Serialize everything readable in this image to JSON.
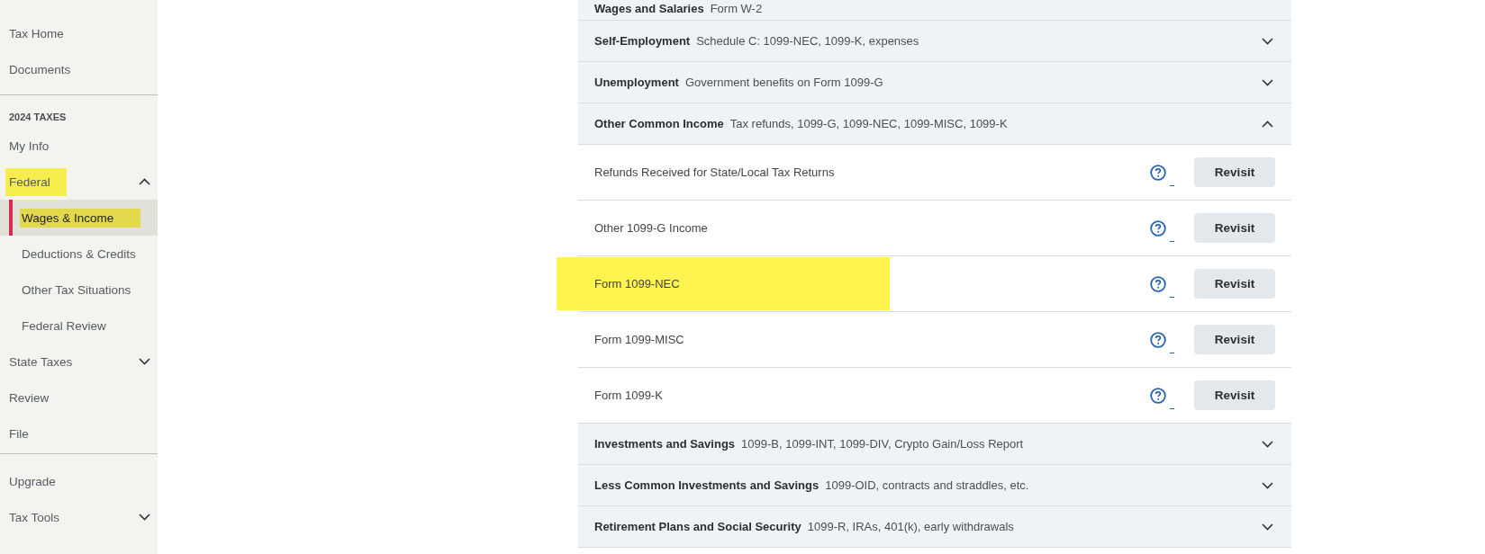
{
  "sidebar": {
    "sections": [
      {
        "items": [
          {
            "label": "Tax Home",
            "selected": false,
            "highlighted": false
          },
          {
            "label": "Documents",
            "selected": false,
            "highlighted": false
          }
        ]
      },
      {
        "heading": "2024 TAXES",
        "items": [
          {
            "label": "My Info",
            "selected": false,
            "highlighted": false
          },
          {
            "label": "Federal",
            "selected": false,
            "highlighted": true,
            "expanded": true,
            "children": [
              {
                "label": "Wages & Income",
                "selected": true,
                "highlighted": true
              },
              {
                "label": "Deductions & Credits",
                "selected": false,
                "highlighted": false
              },
              {
                "label": "Other Tax Situations",
                "selected": false,
                "highlighted": false
              },
              {
                "label": "Federal Review",
                "selected": false,
                "highlighted": false
              }
            ]
          },
          {
            "label": "State Taxes",
            "selected": false,
            "highlighted": false,
            "expanded": false
          },
          {
            "label": "Review",
            "selected": false,
            "highlighted": false
          },
          {
            "label": "File",
            "selected": false,
            "highlighted": false
          }
        ]
      },
      {
        "items": [
          {
            "label": "Upgrade",
            "selected": false,
            "highlighted": false
          },
          {
            "label": "Tax Tools",
            "selected": false,
            "highlighted": false,
            "expanded": false
          }
        ]
      }
    ]
  },
  "income_sections": [
    {
      "title": "Wages and Salaries",
      "description": "Form W-2"
    },
    {
      "title": "Self-Employment",
      "description": "Schedule C: 1099-NEC, 1099-K, expenses",
      "expanded": false
    },
    {
      "title": "Unemployment",
      "description": "Government benefits on Form 1099-G",
      "expanded": false
    },
    {
      "title": "Other Common Income",
      "description": "Tax refunds, 1099-G, 1099-NEC, 1099-MISC, 1099-K",
      "expanded": true,
      "topics": [
        {
          "label": "Refunds Received for State/Local Tax Returns",
          "highlighted": false,
          "button": "Revisit"
        },
        {
          "label": "Other 1099-G Income",
          "highlighted": false,
          "button": "Revisit"
        },
        {
          "label": "Form 1099-NEC",
          "highlighted": true,
          "button": "Revisit"
        },
        {
          "label": "Form 1099-MISC",
          "highlighted": false,
          "button": "Revisit"
        },
        {
          "label": "Form 1099-K",
          "highlighted": false,
          "button": "Revisit"
        }
      ]
    },
    {
      "title": "Investments and Savings",
      "description": "1099-B, 1099-INT, 1099-DIV, Crypto Gain/Loss Report",
      "expanded": false
    },
    {
      "title": "Less Common Investments and Savings",
      "description": "1099-OID, contracts and straddles, etc.",
      "expanded": false
    },
    {
      "title": "Retirement Plans and Social Security",
      "description": "1099-R, IRAs, 401(k), early withdrawals",
      "expanded": false
    }
  ]
}
